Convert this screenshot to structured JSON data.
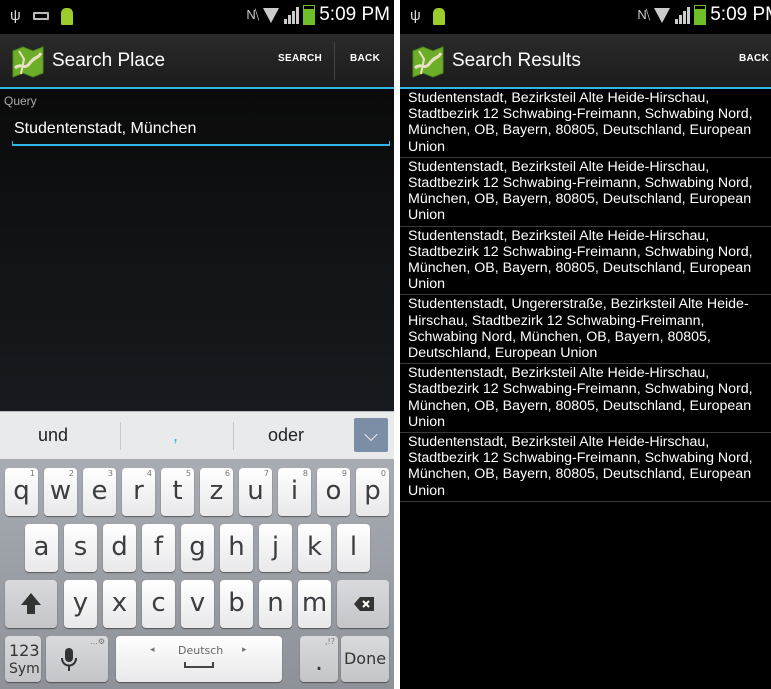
{
  "status_bar": {
    "time": "5:09 PM"
  },
  "colors": {
    "accent": "#33b5e5",
    "battery": "#6fbf2a",
    "app_icon_green": "#6cae2a",
    "app_icon_road": "#e8e2c2"
  },
  "icons": {
    "usb": "usb-icon",
    "notification": "android-icon",
    "nfc": "nfc-icon",
    "wifi": "wifi-icon",
    "signal": "signal-icon",
    "battery": "battery-icon",
    "app": "map-app-icon",
    "shift": "shift-icon",
    "delete": "backspace-icon",
    "mic": "microphone-icon",
    "collapse": "chevron-down-icon"
  },
  "search_screen": {
    "title": "Search Place",
    "search_action": "SEARCH",
    "back_action": "BACK",
    "query_label": "Query",
    "query_value": "Studentenstadt, München",
    "suggestions": [
      "und",
      ",",
      "oder"
    ],
    "keyboard": {
      "row1": [
        {
          "main": "q",
          "sub": "1"
        },
        {
          "main": "w",
          "sub": "2"
        },
        {
          "main": "e",
          "sub": "3"
        },
        {
          "main": "r",
          "sub": "4"
        },
        {
          "main": "t",
          "sub": "5"
        },
        {
          "main": "z",
          "sub": "6"
        },
        {
          "main": "u",
          "sub": "7"
        },
        {
          "main": "i",
          "sub": "8"
        },
        {
          "main": "o",
          "sub": "9"
        },
        {
          "main": "p",
          "sub": "0"
        }
      ],
      "row2": [
        "a",
        "s",
        "d",
        "f",
        "g",
        "h",
        "j",
        "k",
        "l"
      ],
      "row3": [
        "y",
        "x",
        "c",
        "v",
        "b",
        "n",
        "m"
      ],
      "sym_top": "123",
      "sym_bottom": "Sym",
      "space_label": "Deutsch",
      "period": ".",
      "period_sub": ",!?",
      "mic_sub": "…⚙",
      "done": "Done"
    }
  },
  "results_screen": {
    "title": "Search Results",
    "back_action": "BACK",
    "results": [
      "Studentenstadt, Bezirksteil Alte Heide-Hirschau, Stadtbezirk 12 Schwabing-Freimann, Schwabing Nord, München, OB, Bayern, 80805, Deutschland, European Union",
      "Studentenstadt, Bezirksteil Alte Heide-Hirschau, Stadtbezirk 12 Schwabing-Freimann, Schwabing Nord, München, OB, Bayern, 80805, Deutschland, European Union",
      "Studentenstadt, Bezirksteil Alte Heide-Hirschau, Stadtbezirk 12 Schwabing-Freimann, Schwabing Nord, München, OB, Bayern, 80805, Deutschland, European Union",
      "Studentenstadt, Ungererstraße, Bezirksteil Alte Heide-Hirschau, Stadtbezirk 12 Schwabing-Freimann, Schwabing Nord, München, OB, Bayern, 80805, Deutschland, European Union",
      "Studentenstadt, Bezirksteil Alte Heide-Hirschau, Stadtbezirk 12 Schwabing-Freimann, Schwabing Nord, München, OB, Bayern, 80805, Deutschland, European Union",
      "Studentenstadt, Bezirksteil Alte Heide-Hirschau, Stadtbezirk 12 Schwabing-Freimann, Schwabing Nord, München, OB, Bayern, 80805, Deutschland, European Union"
    ]
  }
}
